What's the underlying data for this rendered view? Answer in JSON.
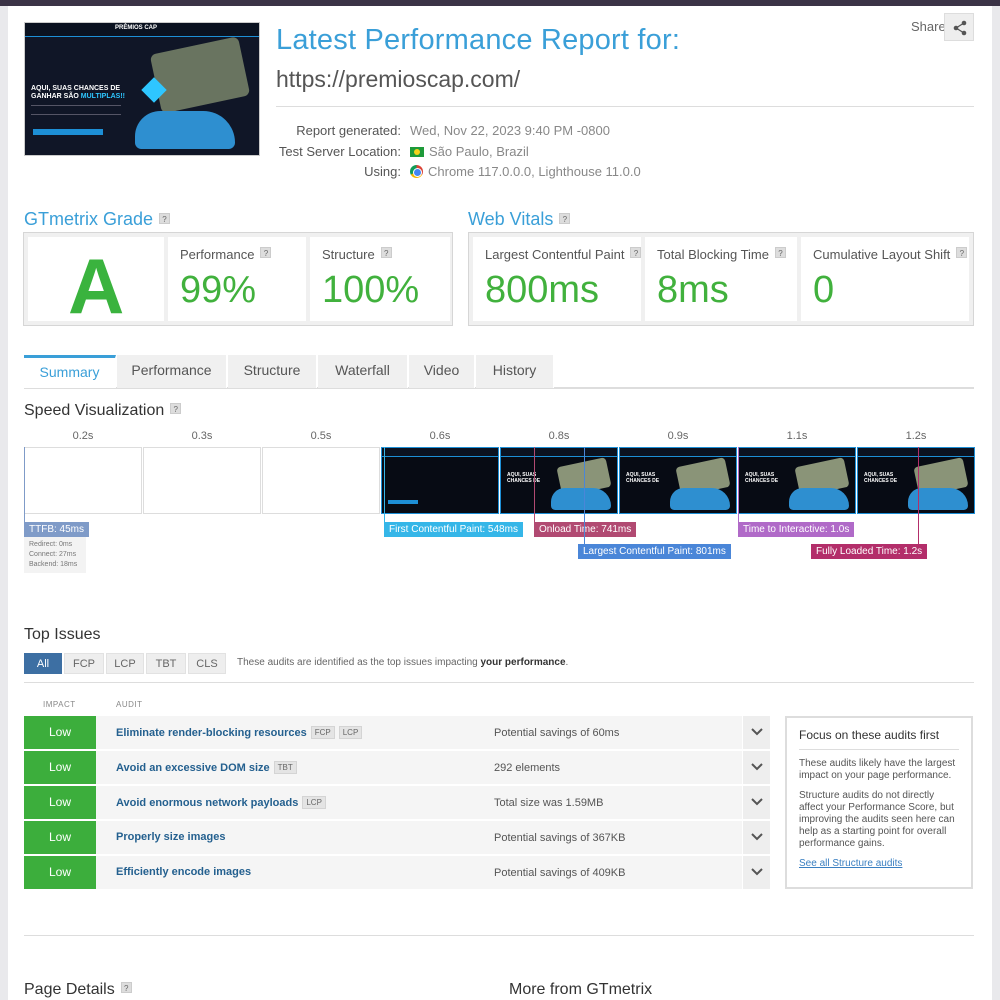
{
  "header": {
    "title": "Latest Performance Report for:",
    "url": "https://premioscap.com/",
    "share_label": "Share",
    "meta": [
      {
        "label": "Report generated:",
        "value": "Wed, Nov 22, 2023 9:40 PM -0800"
      },
      {
        "label": "Test Server Location:",
        "value": "São Paulo, Brazil"
      },
      {
        "label": "Using:",
        "value": "Chrome 117.0.0.0, Lighthouse 11.0.0"
      }
    ],
    "thumbnail": {
      "brand": "PRÊMIOS CAP",
      "hero_line1": "AQUI, SUAS CHANCES DE",
      "hero_line2": "GANHAR SÃO",
      "hero_highlight": "MULTIPLAS!!"
    }
  },
  "grade": {
    "title": "GTmetrix Grade",
    "letter": "A",
    "performance_label": "Performance",
    "performance_value": "99%",
    "structure_label": "Structure",
    "structure_value": "100%"
  },
  "vitals": {
    "title": "Web Vitals",
    "items": [
      {
        "label": "Largest Contentful Paint",
        "value": "800ms"
      },
      {
        "label": "Total Blocking Time",
        "value": "8ms"
      },
      {
        "label": "Cumulative Layout Shift",
        "value": "0"
      }
    ]
  },
  "tabs": [
    "Summary",
    "Performance",
    "Structure",
    "Waterfall",
    "Video",
    "History"
  ],
  "speed": {
    "title": "Speed Visualization",
    "ticks": [
      "0.2s",
      "0.3s",
      "0.5s",
      "0.6s",
      "0.8s",
      "0.9s",
      "1.1s",
      "1.2s"
    ],
    "markers": {
      "ttfb": "TTFB: 45ms",
      "ttfb_details": [
        "Redirect: 0ms",
        "Connect: 27ms",
        "Backend: 18ms"
      ],
      "fcp": "First Contentful Paint: 548ms",
      "onload": "Onload Time: 741ms",
      "lcp": "Largest Contentful Paint: 801ms",
      "tti": "Time to Interactive: 1.0s",
      "fully_loaded": "Fully Loaded Time: 1.2s"
    },
    "colors": {
      "ttfb": "#7f9bc8",
      "fcp": "#35b6e8",
      "onload": "#b14a72",
      "lcp": "#4a86d8",
      "tti": "#b06ac8",
      "fully": "#b32e6a"
    }
  },
  "issues": {
    "title": "Top Issues",
    "filters": [
      "All",
      "FCP",
      "LCP",
      "TBT",
      "CLS"
    ],
    "note_prefix": "These audits are identified as the top issues impacting",
    "note_bold": "your performance",
    "note_suffix": ".",
    "col_impact": "IMPACT",
    "col_audit": "AUDIT",
    "rows": [
      {
        "impact": "Low",
        "audit": "Eliminate render-blocking resources",
        "tags": [
          "FCP",
          "LCP"
        ],
        "detail": "Potential savings of 60ms"
      },
      {
        "impact": "Low",
        "audit": "Avoid an excessive DOM size",
        "tags": [
          "TBT"
        ],
        "detail": "292 elements"
      },
      {
        "impact": "Low",
        "audit": "Avoid enormous network payloads",
        "tags": [
          "LCP"
        ],
        "detail": "Total size was 1.59MB"
      },
      {
        "impact": "Low",
        "audit": "Properly size images",
        "tags": [],
        "detail": "Potential savings of 367KB"
      },
      {
        "impact": "Low",
        "audit": "Efficiently encode images",
        "tags": [],
        "detail": "Potential savings of 409KB"
      }
    ],
    "focus": {
      "title": "Focus on these audits first",
      "p1": "These audits likely have the largest impact on your page performance.",
      "p2": "Structure audits do not directly affect your Performance Score, but improving the audits seen here can help as a starting point for overall performance gains.",
      "link": "See all Structure audits"
    }
  },
  "footer": {
    "page_details": "Page Details",
    "more_from": "More from GTmetrix"
  }
}
